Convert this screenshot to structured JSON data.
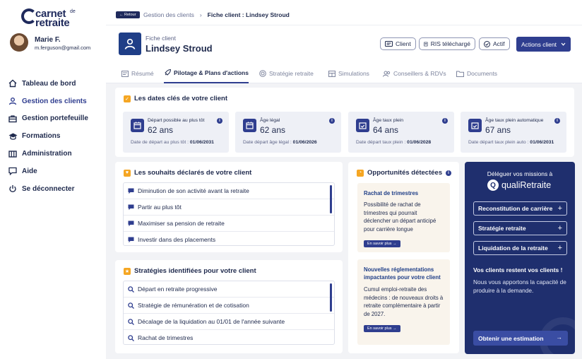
{
  "brand": {
    "line1": "carnet",
    "sup": "de",
    "line2": "retraite"
  },
  "user": {
    "name": "Marie F.",
    "email": "m.ferguson@gmail.com"
  },
  "sidebar": {
    "items": [
      {
        "label": "Tableau de bord",
        "icon": "home-icon"
      },
      {
        "label": "Gestion des clients",
        "icon": "user-icon",
        "active": true
      },
      {
        "label": "Gestion portefeuille",
        "icon": "briefcase-icon"
      },
      {
        "label": "Formations",
        "icon": "graduation-cap-icon"
      },
      {
        "label": "Administration",
        "icon": "columns-icon"
      },
      {
        "label": "Aide",
        "icon": "chat-icon"
      },
      {
        "label": "Se déconnecter",
        "icon": "power-icon"
      }
    ]
  },
  "topbar": {
    "back_label": "Retour",
    "crumb1": "Gestion des clients",
    "crumb2": "Fiche client : Lindsey Stroud"
  },
  "client": {
    "label": "Fiche client",
    "name": "Lindsey Stroud",
    "pill_client": "Client",
    "pill_ris": "RIS téléchargé",
    "pill_actif": "Actif",
    "actions": "Actions client"
  },
  "tabs": [
    {
      "label": "Résumé"
    },
    {
      "label": "Pilotage & Plans d'actions",
      "active": true
    },
    {
      "label": "Stratégie retraite"
    },
    {
      "label": "Simulations"
    },
    {
      "label": "Conseillers & RDVs"
    },
    {
      "label": "Documents"
    }
  ],
  "dates": {
    "title": "Les dates clés de votre client",
    "items": [
      {
        "label": "Départ possible au plus tôt",
        "value": "62 ans",
        "sub_label": "Date de départ au plus tôt :",
        "sub_value": "01/06/2031"
      },
      {
        "label": "Âge légal",
        "value": "62 ans",
        "sub_label": "Date départ âge légal :",
        "sub_value": "01/06/2026"
      },
      {
        "label": "Âge taux plein",
        "value": "64 ans",
        "sub_label": "Date départ taux plein :",
        "sub_value": "01/06/2028"
      },
      {
        "label": "Âge taux plein automatique",
        "value": "67 ans",
        "sub_label": "Date départ taux plein auto :",
        "sub_value": "01/06/2031"
      }
    ]
  },
  "wishes": {
    "title": "Les souhaits déclarés de votre client",
    "items": [
      "Diminution de son activité avant la retraite",
      "Partir au plus tôt",
      "Maximiser sa pension de retraite",
      "Investir dans des placements"
    ]
  },
  "strategies": {
    "title": "Stratégies identifiées pour votre client",
    "items": [
      "Départ en retraite progressive",
      "Stratégie de rémunération et de cotisation",
      "Décalage de la liquidation au 01/01 de l'année suivante",
      "Rachat de trimestres"
    ]
  },
  "opportunities": {
    "title": "Opportunités détectées",
    "items": [
      {
        "title": "Rachat de trimestres",
        "desc": "Possibilité de rachat de trimestres qui pourrait déclencher un départ anticipé pour carrière longue",
        "button": "En savoir plus →"
      },
      {
        "title": "Nouvelles réglementations impactantes pour votre client",
        "desc": "Cumul emploi-retraite des médecins : de nouveaux droits à retraite complémentaire à partir de 2027.",
        "button": "En savoir plus →"
      }
    ]
  },
  "delegate": {
    "title": "Déléguer vos missions à",
    "brand": "qualiRetraite",
    "missions": [
      "Reconstitution de carrière",
      "Stratégie retraite",
      "Liquidation de la retraite"
    ],
    "heading": "Vos clients restent vos clients !",
    "text": "Nous vous apportons la capacité de produire à la demande.",
    "cta": "Obtenir une estimation",
    "cta_arrow": "→"
  },
  "colors": {
    "primary": "#2f3e8f",
    "navy": "#1f2f6e",
    "accent_orange": "#f5a623",
    "card_bg": "#ffffff",
    "page_bg": "#f2f3f6"
  }
}
